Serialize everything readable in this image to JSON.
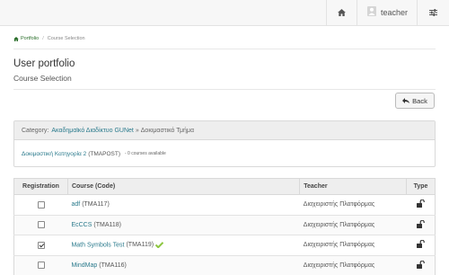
{
  "navbar": {
    "user_name": "teacher"
  },
  "breadcrumb": {
    "items": [
      "Portfolio",
      "Course Selection"
    ]
  },
  "page": {
    "title": "User portfolio",
    "subtitle": "Course Selection"
  },
  "back_button": {
    "label": "Back"
  },
  "category": {
    "prefix": "Category:",
    "path_link": "Ακαδημαϊκό Διαδίκτυο GUNet",
    "separator": "»",
    "path_current": "Δοκιμαστικό Τμήμα",
    "subcategory": {
      "name": "Δοκιμαστική Κατηγορία 2",
      "code": "(TMAPOST)",
      "count": "- 0 courses available"
    }
  },
  "table": {
    "headers": {
      "registration": "Registration",
      "course": "Course (Code)",
      "teacher": "Teacher",
      "type": "Type"
    },
    "rows": [
      {
        "registered": false,
        "course": "adf",
        "code": "(TMA117)",
        "teacher": "Διαχειριστής Πλατφόρμας",
        "type_icon": "unlock-icon"
      },
      {
        "registered": false,
        "course": "EcCCS",
        "code": "(TMA118)",
        "teacher": "Διαχειριστής Πλατφόρμας",
        "type_icon": "unlock-icon"
      },
      {
        "registered": true,
        "course": "Math Symbols Test",
        "code": "(TMA119)",
        "teacher": "Διαχειριστής Πλατφόρμας",
        "type_icon": "unlock-icon"
      },
      {
        "registered": false,
        "course": "MindMap",
        "code": "(TMA116)",
        "teacher": "Διαχειριστής Πλατφόρμας",
        "type_icon": "unlock-icon"
      }
    ]
  },
  "colors": {
    "link": "#2a7a8c",
    "breadcrumb_link": "#2a6e2a",
    "registered_tick": "#8dc63f"
  }
}
